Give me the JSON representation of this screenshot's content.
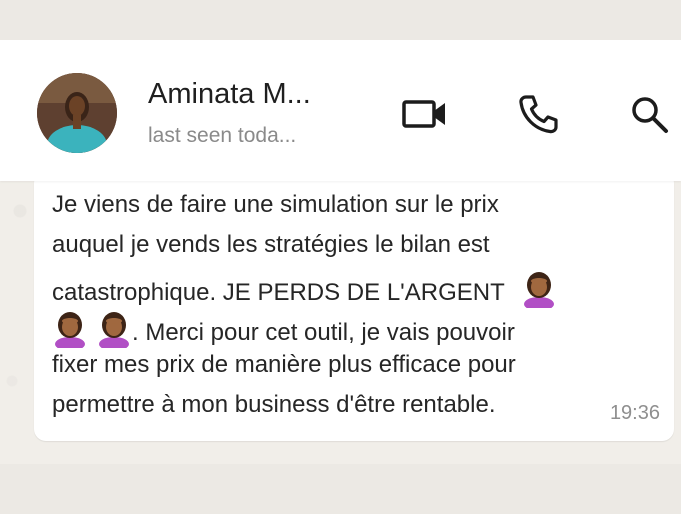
{
  "header": {
    "contact_name": "Aminata M...",
    "last_seen": "last seen toda...",
    "icons": [
      "video-camera-icon",
      "phone-icon",
      "search-icon"
    ]
  },
  "message": {
    "lines": [
      "Je viens de faire une simulation sur le prix",
      "auquel je vends les stratégies le bilan est",
      "catastrophique. JE PERDS DE L'ARGENT",
      ". Merci pour cet outil, je vais pouvoir",
      "fixer mes prix de manière plus efficace pour",
      "permettre à mon business d'être rentable."
    ],
    "emojis": [
      "woman-facepalming-emoji",
      "woman-facepalming-emoji",
      "woman-facepalming-emoji"
    ],
    "time": "19:36"
  },
  "colors": {
    "header_bg": "#ffffff",
    "chat_bg": "#f1eee9",
    "bubble_bg": "#ffffff",
    "emoji_skin": "#a0683f",
    "emoji_shirt": "#b14fc5"
  }
}
